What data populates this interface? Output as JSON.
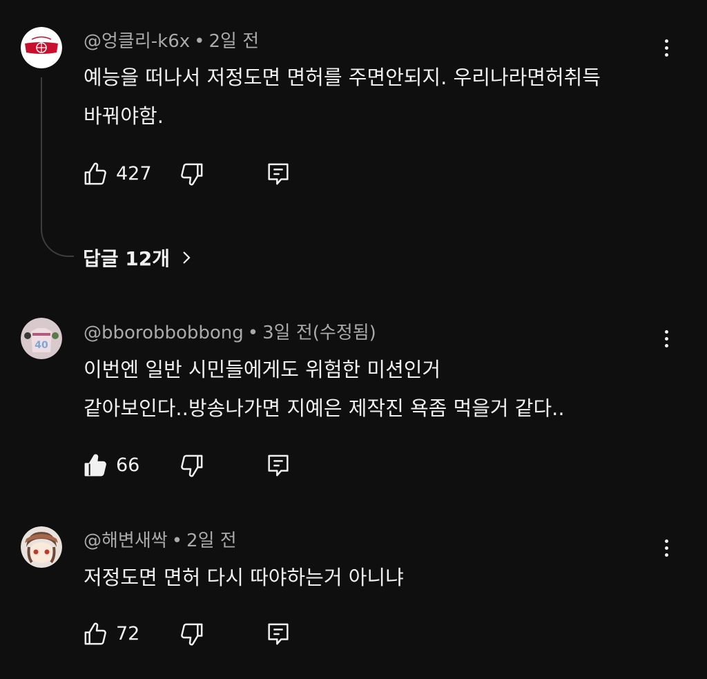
{
  "comments": [
    {
      "author": "@엉클리-k6x",
      "time": "2일 전",
      "lines": [
        "예능을 떠나서 저정도면 면허를 주면안되지. 우리나라면허취득",
        "바꿔야함."
      ],
      "likes": "427",
      "liked": false,
      "replies_label": "답글 12개"
    },
    {
      "author": "@bborobbobbong",
      "time": "3일 전(수정됨)",
      "lines": [
        "이번엔 일반 시민들에게도 위험한 미션인거",
        "같아보인다..방송나가면 지예은 제작진 욕좀 먹을거 같다.."
      ],
      "likes": "66",
      "liked": true
    },
    {
      "author": "@해변새싹",
      "time": "2일 전",
      "lines": [
        "저정도면 면허 다시 따야하는거 아니냐"
      ],
      "likes": "72",
      "liked": false
    }
  ],
  "separator": "•",
  "icons": {
    "like": "thumb-up-icon",
    "dislike": "thumb-down-icon",
    "reply": "reply-icon",
    "more": "more-vertical-icon",
    "chevron": "chevron-right-icon"
  },
  "colors": {
    "background": "#0f0f0f",
    "text": "#f1f1f1",
    "meta": "#aaaaaa",
    "thread_line": "#3d3d3d"
  }
}
